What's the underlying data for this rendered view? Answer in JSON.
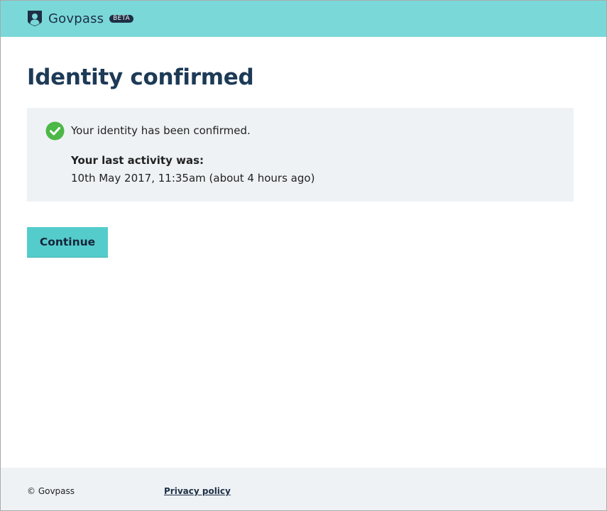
{
  "header": {
    "brand_name": "Govpass",
    "beta_badge": "BETA",
    "logo_icon": "shield-user-icon",
    "background_color": "#7ad8d8"
  },
  "main": {
    "title": "Identity confirmed",
    "status_icon": "check-circle-icon",
    "status_color": "#4cb847",
    "confirmation_message": "Your identity has been confirmed.",
    "last_activity_label": "Your last activity was:",
    "last_activity_value": "10th May 2017, 11:35am (about 4 hours ago)",
    "continue_label": "Continue",
    "accent_color": "#55cccc"
  },
  "footer": {
    "copyright": "© Govpass",
    "privacy_link": "Privacy policy"
  }
}
